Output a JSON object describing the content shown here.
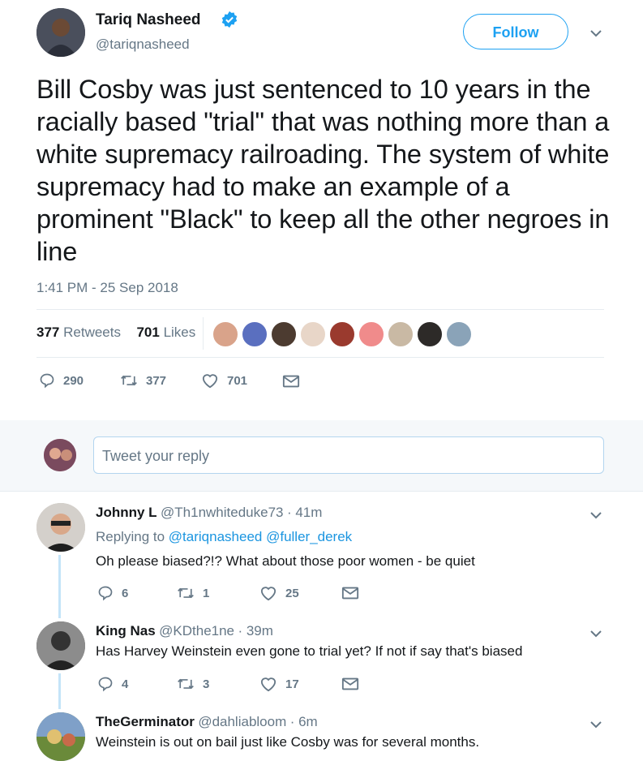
{
  "main_tweet": {
    "author_name": "Tariq Nasheed",
    "author_handle": "@tariqnasheed",
    "follow_label": "Follow",
    "text": "Bill Cosby was just sentenced to 10 years in the racially based \"trial\" that was nothing more than a white supremacy railroading. The system of white supremacy had to make an example of a prominent \"Black\" to keep all the other negroes in line",
    "timestamp": "1:41 PM - 25 Sep 2018",
    "retweets_count": "377",
    "retweets_label": "Retweets",
    "likes_count": "701",
    "likes_label": "Likes",
    "actions": {
      "replies": "290",
      "retweets": "377",
      "likes": "701"
    }
  },
  "reply_box": {
    "placeholder": "Tweet your reply"
  },
  "replies": [
    {
      "name": "Johnny L",
      "handle": "@Th1nwhiteduke73",
      "time": "· 41m",
      "replying_prefix": "Replying to",
      "replying_to_1": "@tariqnasheed",
      "replying_to_2": "@fuller_derek",
      "text": "Oh please biased?!? What about those poor women - be quiet",
      "replies": "6",
      "retweets": "1",
      "likes": "25"
    },
    {
      "name": "King Nas",
      "handle": "@KDthe1ne",
      "time": "· 39m",
      "text": "Has Harvey Weinstein even gone to trial yet? If not if say that's biased",
      "replies": "4",
      "retweets": "3",
      "likes": "17"
    },
    {
      "name": "TheGerminator",
      "handle": "@dahliabloom",
      "time": "· 6m",
      "text": "Weinstein is out on bail just like Cosby was for several months."
    }
  ],
  "colors": {
    "accent": "#1da1f2",
    "muted": "#657786",
    "text": "#14171a",
    "divider": "#e6ecf0"
  }
}
